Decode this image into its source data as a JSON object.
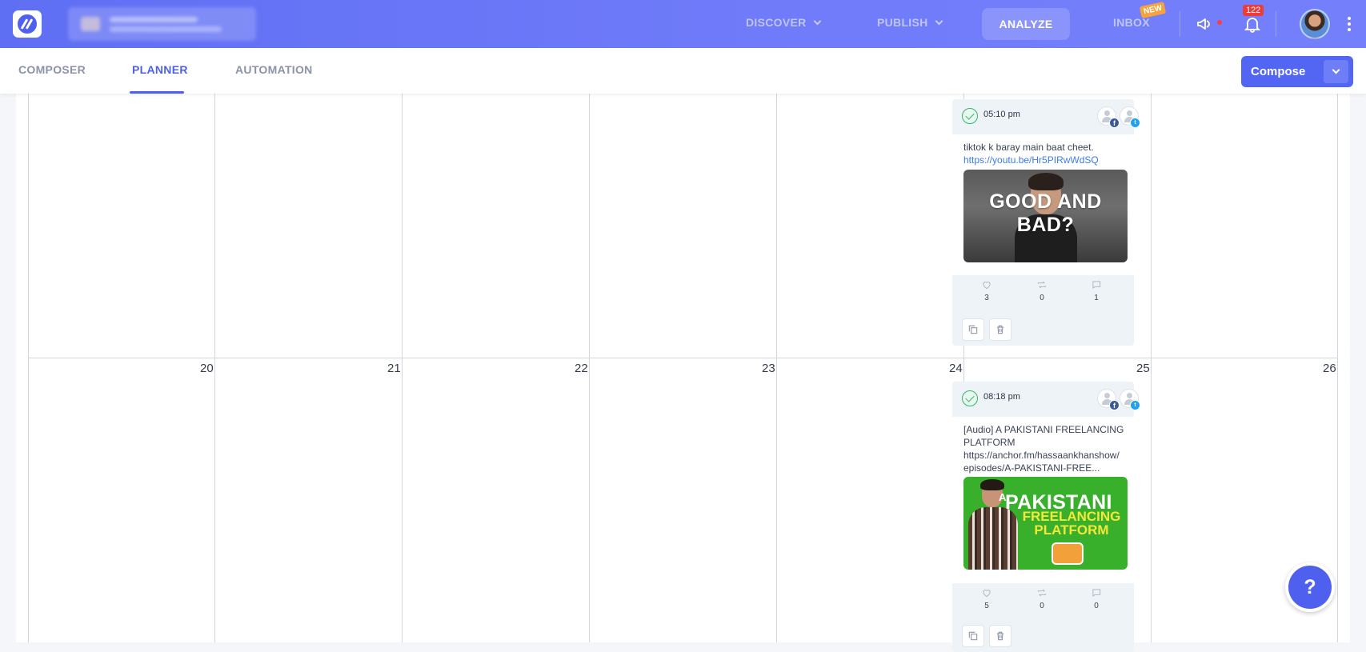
{
  "nav": {
    "discover": "DISCOVER",
    "publish": "PUBLISH",
    "analyze": "ANALYZE",
    "inbox": "INBOX",
    "inbox_badge": "NEW",
    "notification_count": "122"
  },
  "subnav": {
    "tabs": [
      {
        "label": "COMPOSER",
        "active": false
      },
      {
        "label": "PLANNER",
        "active": true
      },
      {
        "label": "AUTOMATION",
        "active": false
      }
    ],
    "compose_label": "Compose"
  },
  "calendar": {
    "days": [
      "20",
      "21",
      "22",
      "23",
      "24",
      "25",
      "26"
    ]
  },
  "posts": [
    {
      "time": "05:10 pm",
      "text": "tiktok k baray main baat cheet.",
      "link": "https://youtu.be/Hr5PIRwWdSQ",
      "thumb_text": "GOOD AND BAD?",
      "likes": "3",
      "retweets": "0",
      "comments": "1"
    },
    {
      "time": "08:18 pm",
      "text": "[Audio] A PAKISTANI FREELANCING PLATFORM https://anchor.fm/hassaankhanshow/ episodes/A-PAKISTANI-FREE...",
      "thumb_line1a": "A",
      "thumb_line1": "PAKISTANI",
      "thumb_line2": "FREELANCING PLATFORM",
      "likes": "5",
      "retweets": "0",
      "comments": "0"
    }
  ],
  "help_label": "?"
}
